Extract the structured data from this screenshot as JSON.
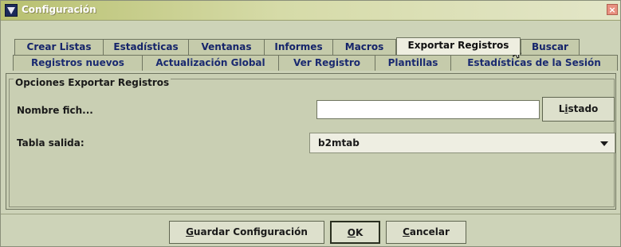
{
  "window": {
    "title": "Configuración",
    "close_glyph": "×"
  },
  "tabs_row1": [
    {
      "label": "Crear Listas"
    },
    {
      "label": "Estadísticas"
    },
    {
      "label": "Ventanas"
    },
    {
      "label": "Informes"
    },
    {
      "label": "Macros"
    },
    {
      "label": "Exportar Registros",
      "selected": true
    },
    {
      "label": "Buscar"
    }
  ],
  "tabs_row2": [
    {
      "label": "Registros nuevos"
    },
    {
      "label": "Actualización Global"
    },
    {
      "label": "Ver Registro"
    },
    {
      "label": "Plantillas"
    },
    {
      "label": "Estadísticas de la Sesión"
    }
  ],
  "group": {
    "title": "Opciones Exportar Registros"
  },
  "fields": {
    "filename_label": "Nombre fich...",
    "filename_value": "",
    "browse_button": {
      "prefix": "L",
      "underlined": "i",
      "rest": "stado"
    },
    "table_label": "Tabla salida:",
    "table_value": "b2mtab"
  },
  "footer": {
    "save_button": {
      "underlined": "G",
      "rest": "uardar Configuración"
    },
    "ok_button": {
      "underlined": "O",
      "rest": "K"
    },
    "cancel_button": {
      "underlined": "C",
      "rest": "ancelar"
    }
  },
  "colors": {
    "accent": "#15246a",
    "background": "#cdd3b8"
  }
}
